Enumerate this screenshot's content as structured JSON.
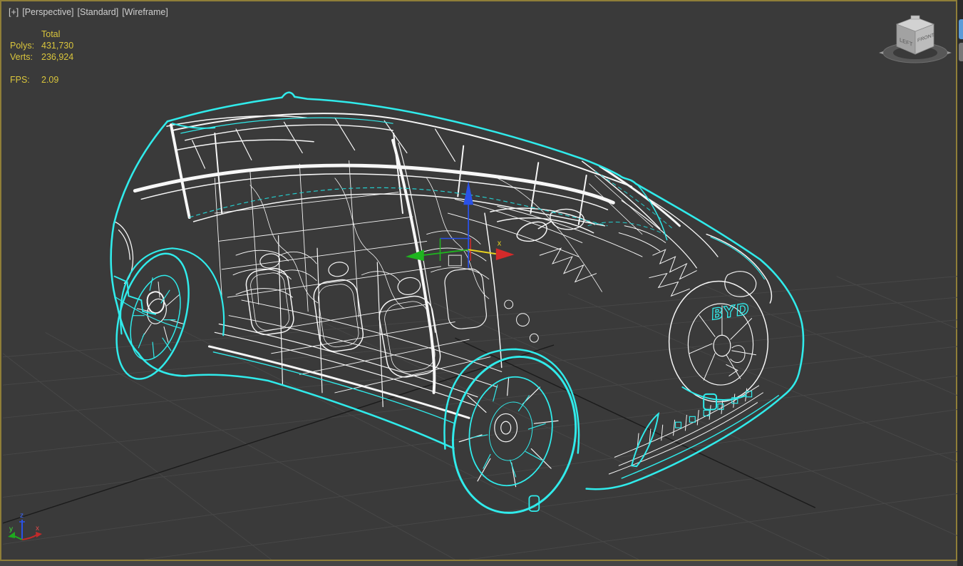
{
  "viewport": {
    "menu_plus": "[+]",
    "menu_pov": "[Perspective]",
    "menu_preset": "[Standard]",
    "menu_shading": "[Wireframe]"
  },
  "statistics": {
    "header": "Total",
    "rows": [
      {
        "label": "Polys:",
        "value": "431,730"
      },
      {
        "label": "Verts:",
        "value": "236,924"
      }
    ],
    "fps": {
      "label": "FPS:",
      "value": "2.09"
    }
  },
  "viewcube": {
    "face_left": "LEFT",
    "face_front": "FRONT"
  },
  "axis_tripod": {
    "x_label": "x",
    "y_label": "y",
    "z_label": "z"
  },
  "scene": {
    "badge_text": "BYD",
    "colors": {
      "selection_cyan": "#30ebeb",
      "wireframe_white": "#ffffff",
      "viewport_background": "#3a3a3a",
      "grid": "#474747",
      "active_border": "#8f7e38",
      "stats_text": "#d9c53c",
      "gizmo_x": "#d42a2a",
      "gizmo_y": "#1fb41f",
      "gizmo_z": "#2a52e8",
      "gizmo_highlight": "#e8d21f"
    }
  }
}
